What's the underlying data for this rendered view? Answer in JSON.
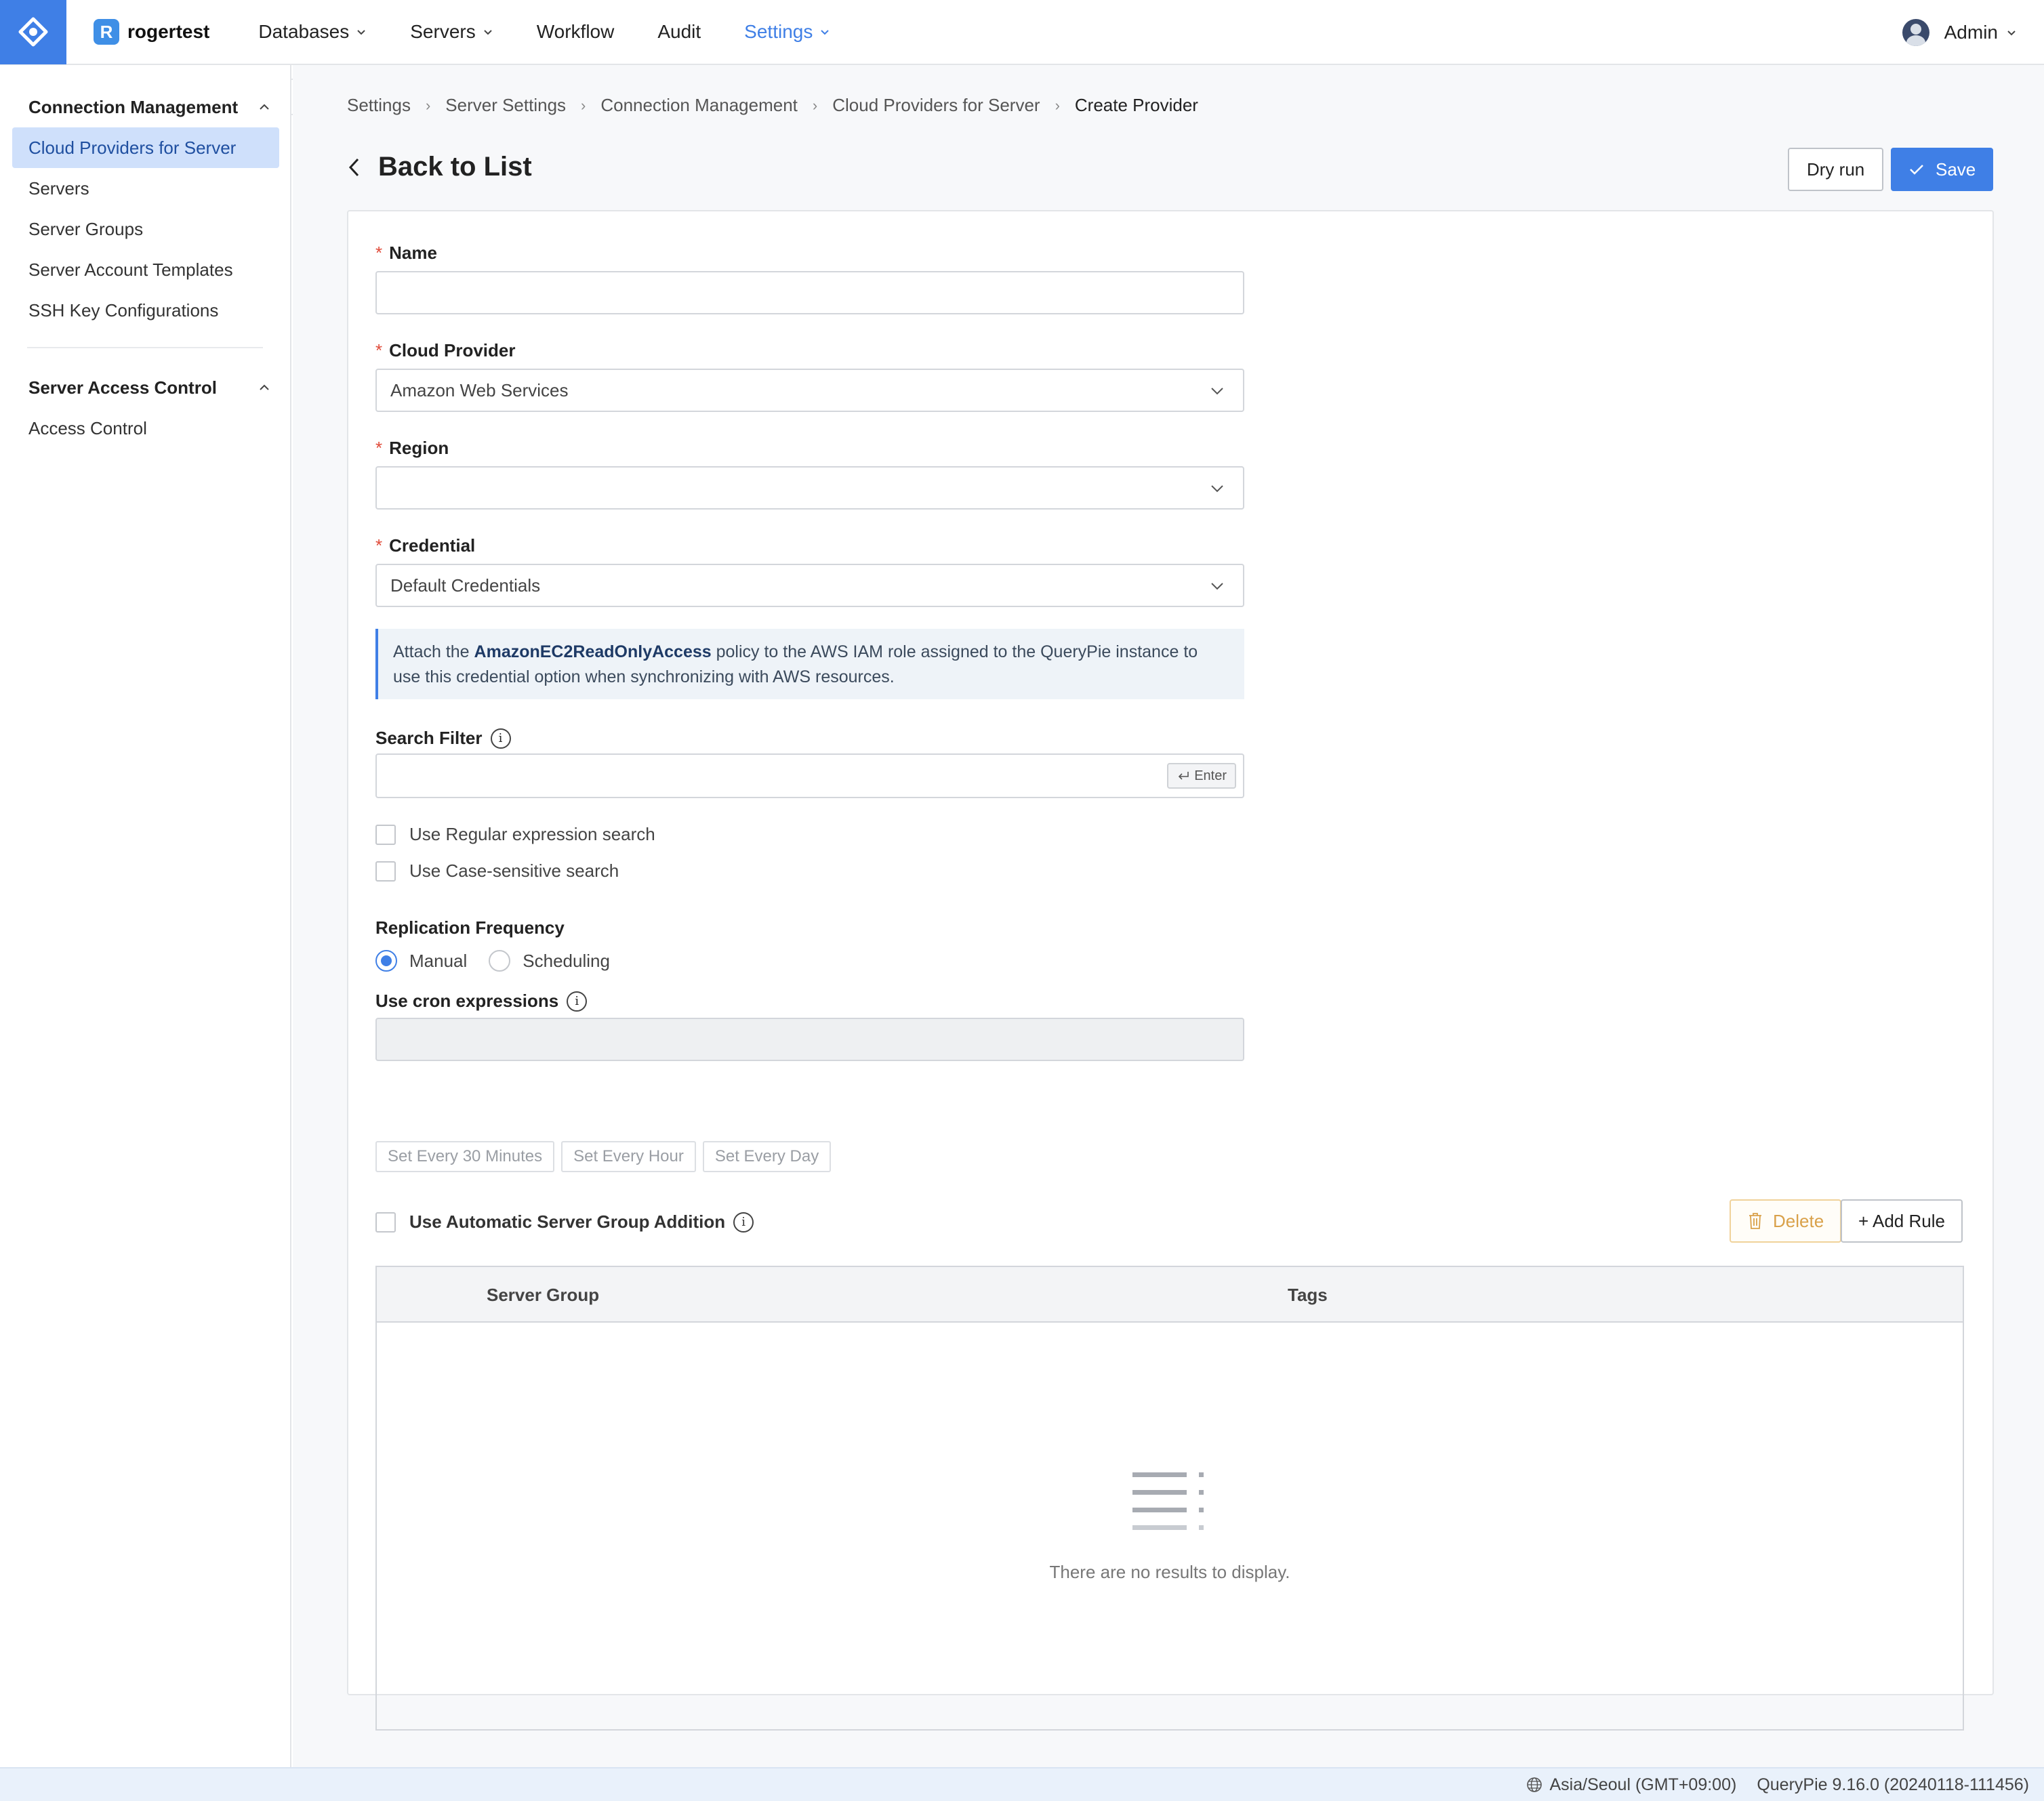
{
  "workspace": {
    "badge": "R",
    "name": "rogertest"
  },
  "nav": {
    "items": [
      {
        "label": "Databases",
        "has_dropdown": true,
        "active": false
      },
      {
        "label": "Servers",
        "has_dropdown": true,
        "active": false
      },
      {
        "label": "Workflow",
        "has_dropdown": false,
        "active": false
      },
      {
        "label": "Audit",
        "has_dropdown": false,
        "active": false
      },
      {
        "label": "Settings",
        "has_dropdown": true,
        "active": true
      }
    ],
    "user": "Admin"
  },
  "sidebar": {
    "sections": [
      {
        "title": "Connection Management",
        "items": [
          "Cloud Providers for Server",
          "Servers",
          "Server Groups",
          "Server Account Templates",
          "SSH Key Configurations"
        ]
      },
      {
        "title": "Server Access Control",
        "items": [
          "Access Control"
        ]
      }
    ],
    "active_item": "Cloud Providers for Server"
  },
  "breadcrumb": [
    "Settings",
    "Server Settings",
    "Connection Management",
    "Cloud Providers for Server",
    "Create Provider"
  ],
  "page": {
    "title": "Back to List",
    "dry_run_label": "Dry run",
    "save_label": "Save"
  },
  "form": {
    "required_mark": "*",
    "name": {
      "label": "Name",
      "value": ""
    },
    "cloud_provider": {
      "label": "Cloud Provider",
      "value": "Amazon Web Services"
    },
    "region": {
      "label": "Region",
      "value": ""
    },
    "credential": {
      "label": "Credential",
      "value": "Default Credentials"
    },
    "info": {
      "prefix": "Attach the ",
      "policy": "AmazonEC2ReadOnlyAccess",
      "suffix": " policy to the AWS IAM role assigned to the QueryPie instance to use this credential option when synchronizing with AWS resources."
    },
    "search_filter": {
      "label": "Search Filter",
      "value": "",
      "enter_chip": "Enter"
    },
    "regex_search": {
      "label": "Use Regular expression search",
      "checked": false
    },
    "case_search": {
      "label": "Use Case-sensitive search",
      "checked": false
    },
    "replication": {
      "label": "Replication Frequency",
      "options": [
        "Manual",
        "Scheduling"
      ],
      "selected": "Manual"
    },
    "cron": {
      "label": "Use cron expressions",
      "value": "",
      "presets": [
        "Set Every 30 Minutes",
        "Set Every Hour",
        "Set Every Day"
      ]
    },
    "auto_group": {
      "label": "Use Automatic Server Group Addition",
      "checked": false
    },
    "delete_label": "Delete",
    "add_rule_label": "+ Add Rule",
    "table": {
      "columns": [
        "Server Group",
        "Tags"
      ],
      "rows": [],
      "empty_text": "There are no results to display."
    }
  },
  "footer": {
    "timezone": "Asia/Seoul (GMT+09:00)",
    "version": "QueryPie 9.16.0 (20240118-111456)"
  },
  "colors": {
    "accent": "#3f7fe6",
    "sidebar_active_bg": "#cfe0fb",
    "required": "#e04b3a",
    "delete": "#d9a14a",
    "footer_bg": "#e9f1fb"
  }
}
